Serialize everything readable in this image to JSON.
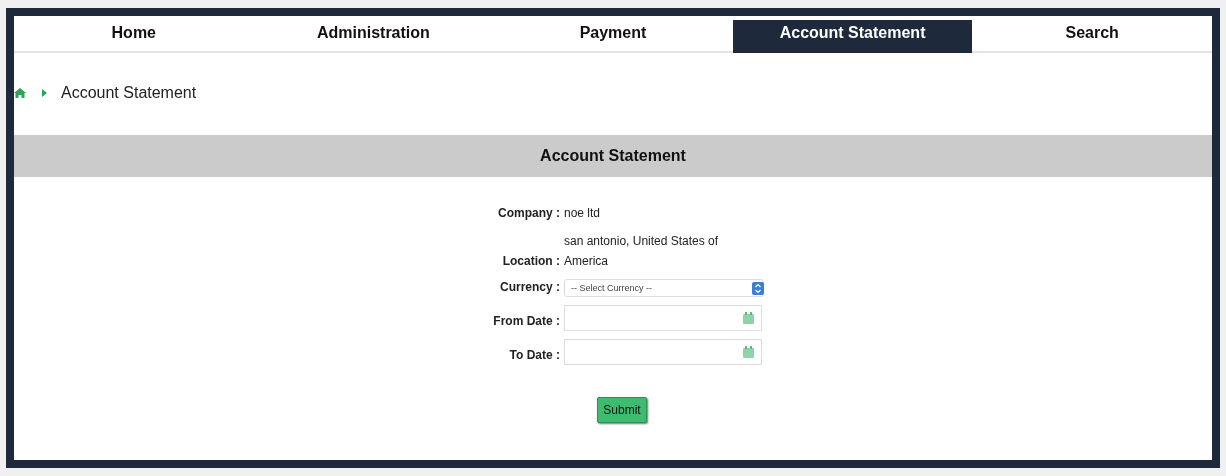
{
  "nav": {
    "tabs": [
      {
        "label": "Home",
        "selected": false
      },
      {
        "label": "Administration",
        "selected": false
      },
      {
        "label": "Payment",
        "selected": false
      },
      {
        "label": "Account Statement",
        "selected": true
      },
      {
        "label": "Search",
        "selected": false
      }
    ]
  },
  "breadcrumb": {
    "current": "Account Statement"
  },
  "panel": {
    "title": "Account Statement",
    "fields": [
      {
        "kind": "text",
        "label": "Company :",
        "value": "noe ltd"
      },
      {
        "kind": "text",
        "label": "Location :",
        "value": "san antonio, United States of America"
      },
      {
        "kind": "select",
        "label": "Currency :",
        "placeholder": "-- Select Currency --"
      },
      {
        "kind": "date",
        "label": "From Date :"
      },
      {
        "kind": "date",
        "label": "To Date :"
      }
    ],
    "submit": "Submit"
  }
}
